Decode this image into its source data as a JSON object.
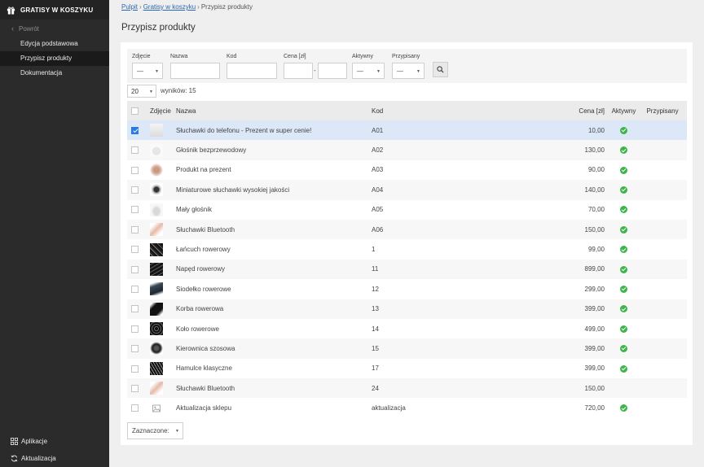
{
  "sidebar": {
    "brand": "GRATISY W KOSZYKU",
    "brand_icon": "gift-icon",
    "back_label": "Powrót",
    "items": [
      {
        "label": "Edycja podstawowa",
        "active": false
      },
      {
        "label": "Przypisz produkty",
        "active": true
      },
      {
        "label": "Dokumentacja",
        "active": false
      }
    ],
    "bottom": [
      {
        "label": "Aplikacje",
        "icon": "apps-grid-icon"
      },
      {
        "label": "Aktualizacja",
        "icon": "refresh-icon"
      }
    ]
  },
  "breadcrumb": [
    "Pulpit",
    "Gratisy w koszyku",
    "Przypisz produkty"
  ],
  "page_title": "Przypisz produkty",
  "filters": {
    "image_label": "Zdjęcie",
    "image_value": "—",
    "name_label": "Nazwa",
    "name_value": "",
    "code_label": "Kod",
    "code_value": "",
    "price_label": "Cena [zł]",
    "price_from": "",
    "price_to": "",
    "price_sep": "-",
    "active_label": "Aktywny",
    "active_value": "—",
    "assigned_label": "Przypisany",
    "assigned_value": "—"
  },
  "per_page": "20",
  "results_text": "wyników: 15",
  "table": {
    "headers": {
      "image": "Zdjęcie",
      "name": "Nazwa",
      "code": "Kod",
      "price": "Cena [zł]",
      "active": "Aktywny",
      "assigned": "Przypisany"
    },
    "rows": [
      {
        "name": "Słuchawki do telefonu - Prezent w super cenie!",
        "code": "A01",
        "price": "10,00",
        "active": true,
        "checked": true,
        "thumb": "t-white"
      },
      {
        "name": "Głośnik bezprzewodowy",
        "code": "A02",
        "price": "130,00",
        "active": true,
        "checked": false,
        "thumb": "t-round"
      },
      {
        "name": "Produkt na prezent",
        "code": "A03",
        "price": "90,00",
        "active": true,
        "checked": false,
        "thumb": "t-rose"
      },
      {
        "name": "Miniaturowe słuchawki wysokiej jakości",
        "code": "A04",
        "price": "140,00",
        "active": true,
        "checked": false,
        "thumb": "t-tiny"
      },
      {
        "name": "Mały głośnik",
        "code": "A05",
        "price": "70,00",
        "active": true,
        "checked": false,
        "thumb": "t-spk"
      },
      {
        "name": "Słuchawki Bluetooth",
        "code": "A06",
        "price": "150,00",
        "active": true,
        "checked": false,
        "thumb": "t-pink"
      },
      {
        "name": "Łańcuch rowerowy",
        "code": "1",
        "price": "99,00",
        "active": true,
        "checked": false,
        "thumb": "t-dark1"
      },
      {
        "name": "Napęd rowerowy",
        "code": "11",
        "price": "899,00",
        "active": true,
        "checked": false,
        "thumb": "t-dark2"
      },
      {
        "name": "Siodełko rowerowe",
        "code": "12",
        "price": "299,00",
        "active": true,
        "checked": false,
        "thumb": "t-dark3"
      },
      {
        "name": "Korba rowerowa",
        "code": "13",
        "price": "399,00",
        "active": true,
        "checked": false,
        "thumb": "t-dark4"
      },
      {
        "name": "Koło rowerowe",
        "code": "14",
        "price": "499,00",
        "active": true,
        "checked": false,
        "thumb": "t-dark5"
      },
      {
        "name": "Kierownica szosowa",
        "code": "15",
        "price": "399,00",
        "active": true,
        "checked": false,
        "thumb": "t-dark7"
      },
      {
        "name": "Hamulce klasyczne",
        "code": "17",
        "price": "399,00",
        "active": true,
        "checked": false,
        "thumb": "t-dark6"
      },
      {
        "name": "Słuchawki Bluetooth",
        "code": "24",
        "price": "150,00",
        "active": false,
        "checked": false,
        "thumb": "t-pink"
      },
      {
        "name": "Aktualizacja sklepu",
        "code": "aktualizacja",
        "price": "720,00",
        "active": true,
        "checked": false,
        "thumb": "t-ph"
      }
    ]
  },
  "bulk_action": "Zaznaczone:",
  "colors": {
    "sidebar_bg": "#2b2b2b",
    "link": "#2a67b3",
    "selected_row": "#dce8f7",
    "active_ok": "#3db54a",
    "checkbox_on": "#2a7ae2"
  }
}
